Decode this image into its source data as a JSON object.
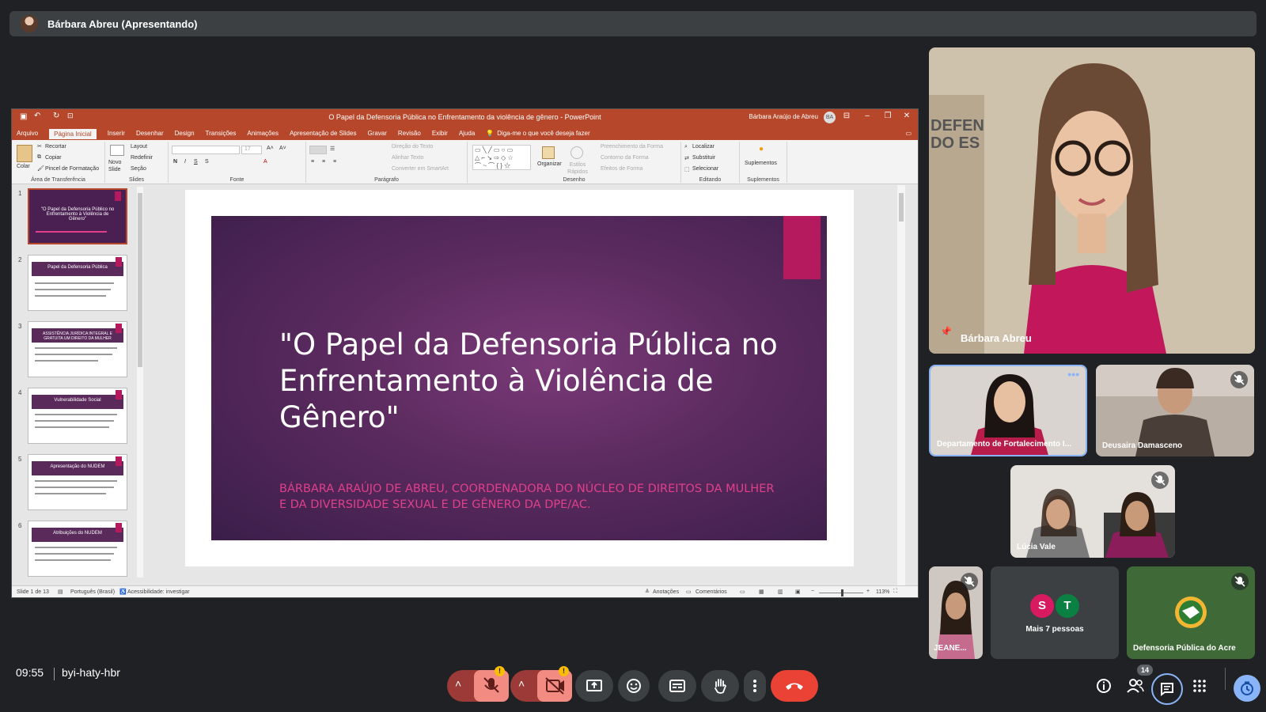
{
  "presenter_bar": {
    "label": "Bárbara Abreu (Apresentando)"
  },
  "powerpoint": {
    "window_title": "O Papel da Defensoria Pública no Enfrentamento da violência de gênero  -  PowerPoint",
    "user_name": "Bárbara Araújo de Abreu",
    "user_initials": "BA",
    "tabs": [
      "Arquivo",
      "Página Inicial",
      "Inserir",
      "Desenhar",
      "Design",
      "Transições",
      "Animações",
      "Apresentação de Slides",
      "Gravar",
      "Revisão",
      "Exibir",
      "Ajuda"
    ],
    "active_tab": "Página Inicial",
    "tell_me": "Diga-me o que você deseja fazer",
    "ribbon": {
      "clipboard": {
        "paste": "Colar",
        "cut": "Recortar",
        "copy": "Copiar",
        "format_painter": "Pincel de Formatação",
        "label": "Área de Transferência"
      },
      "slides": {
        "new_slide": "Novo Slide",
        "layout": "Layout",
        "reset": "Redefinir",
        "section": "Seção",
        "label": "Slides"
      },
      "font": {
        "label": "Fonte",
        "font_size": "17"
      },
      "paragraph": {
        "text_direction": "Direção do Texto",
        "align_text": "Alinhar Texto",
        "smartart": "Converter em SmartArt",
        "label": "Parágrafo"
      },
      "drawing": {
        "arrange": "Organizar",
        "quick_styles": "Estilos Rápidos",
        "shape_fill": "Preenchimento da Forma",
        "shape_outline": "Contorno da Forma",
        "shape_effects": "Efeitos de Forma",
        "label": "Desenho"
      },
      "editing": {
        "find": "Localizar",
        "replace": "Substituir",
        "select": "Selecionar",
        "label": "Editando"
      },
      "addins": {
        "addins": "Suplementos",
        "label": "Suplementos"
      }
    },
    "thumbnails": [
      {
        "num": "1",
        "title": "\"O Papel da Defensoria Público no Enfrentamento à Violência de Gênero\""
      },
      {
        "num": "2",
        "title": "Papel da Defensoria Pública"
      },
      {
        "num": "3",
        "title": "ASSISTÊNCIA JURÍDICA INTEGRAL E GRATUITA UM DIREITO DA MULHER"
      },
      {
        "num": "4",
        "title": "Vulnerabilidade Social"
      },
      {
        "num": "5",
        "title": "Apresentação do NUDEM"
      },
      {
        "num": "6",
        "title": "Atribuições do NUDEM"
      }
    ],
    "slide": {
      "title": "\"O Papel da Defensoria Pública no Enfrentamento à Violência de Gênero\"",
      "subtitle": "BÁRBARA ARAÚJO DE ABREU, COORDENADORA DO NÚCLEO DE DIREITOS DA MULHER E DA DIVERSIDADE SEXUAL E DE GÊNERO DA DPE/AC."
    },
    "status": {
      "slide_of": "Slide 1 de 13",
      "language": "Português (Brasil)",
      "accessibility": "Acessibilidade: investigar",
      "notes": "Anotações",
      "comments": "Comentários",
      "zoom": "113%"
    }
  },
  "participants": {
    "main": {
      "name": "Bárbara Abreu"
    },
    "tiles": [
      {
        "name": "Departamento de Fortalecimento I..."
      },
      {
        "name": "Deusaira Damasceno"
      },
      {
        "name": "Lúcia Vale"
      },
      {
        "name": "JEANE..."
      },
      {
        "name": "Defensoria Pública do Acre"
      }
    ],
    "more": {
      "label": "Mais 7 pessoas",
      "avatars": [
        "S",
        "T"
      ],
      "avatar_colors": [
        "#d81b60",
        "#0b8043"
      ]
    }
  },
  "bottom_bar": {
    "time": "09:55",
    "meeting_code": "byi-haty-hbr",
    "people_count": "14",
    "warning_mark": "!"
  },
  "colors": {
    "ppt_accent": "#b7472a",
    "meet_bg": "#202124",
    "end_call": "#ea4335",
    "active_highlight": "#8ab4f8"
  }
}
